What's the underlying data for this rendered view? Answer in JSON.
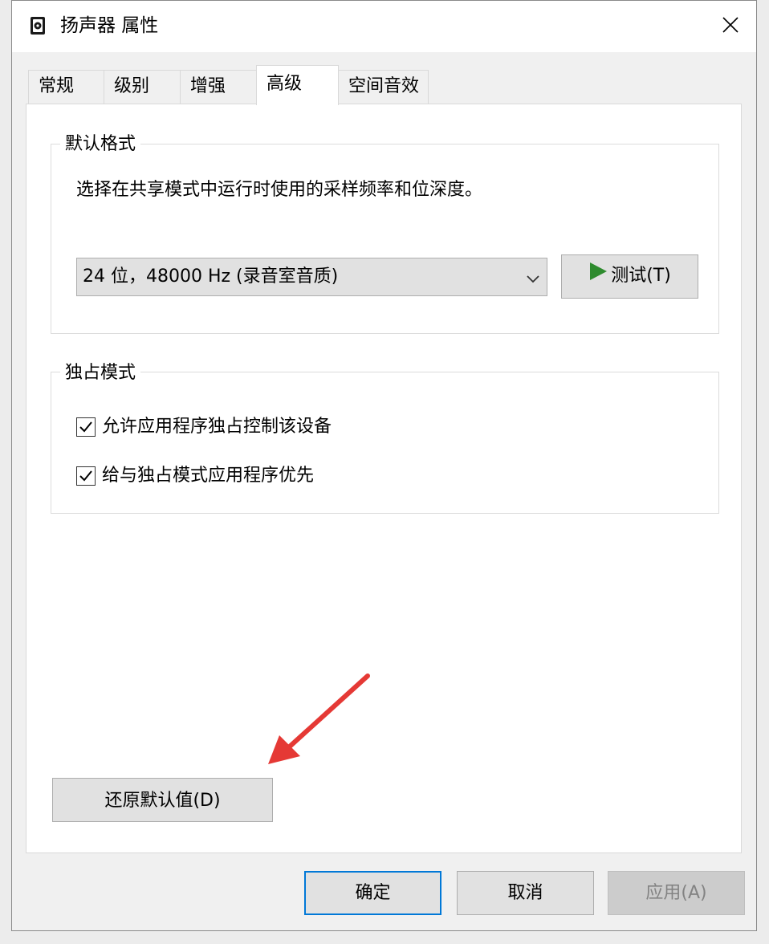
{
  "window": {
    "title": "扬声器 属性",
    "icon": "speaker-icon"
  },
  "tabs": [
    {
      "label": "常规",
      "active": false
    },
    {
      "label": "级别",
      "active": false
    },
    {
      "label": "增强",
      "active": false
    },
    {
      "label": "高级",
      "active": true
    },
    {
      "label": "空间音效",
      "active": false
    }
  ],
  "default_format": {
    "group_title": "默认格式",
    "description": "选择在共享模式中运行时使用的采样频率和位深度。",
    "selected": "24 位，48000 Hz (录音室音质)",
    "test_button": "测试(T)"
  },
  "exclusive_mode": {
    "group_title": "独占模式",
    "options": [
      {
        "label": "允许应用程序独占控制该设备",
        "checked": true
      },
      {
        "label": "给与独占模式应用程序优先",
        "checked": true
      }
    ]
  },
  "restore_button": "还原默认值(D)",
  "footer": {
    "ok": "确定",
    "cancel": "取消",
    "apply": "应用(A)"
  },
  "colors": {
    "accent": "#0078d7",
    "play": "#2e8b2e",
    "annotation_arrow": "#e53935"
  }
}
